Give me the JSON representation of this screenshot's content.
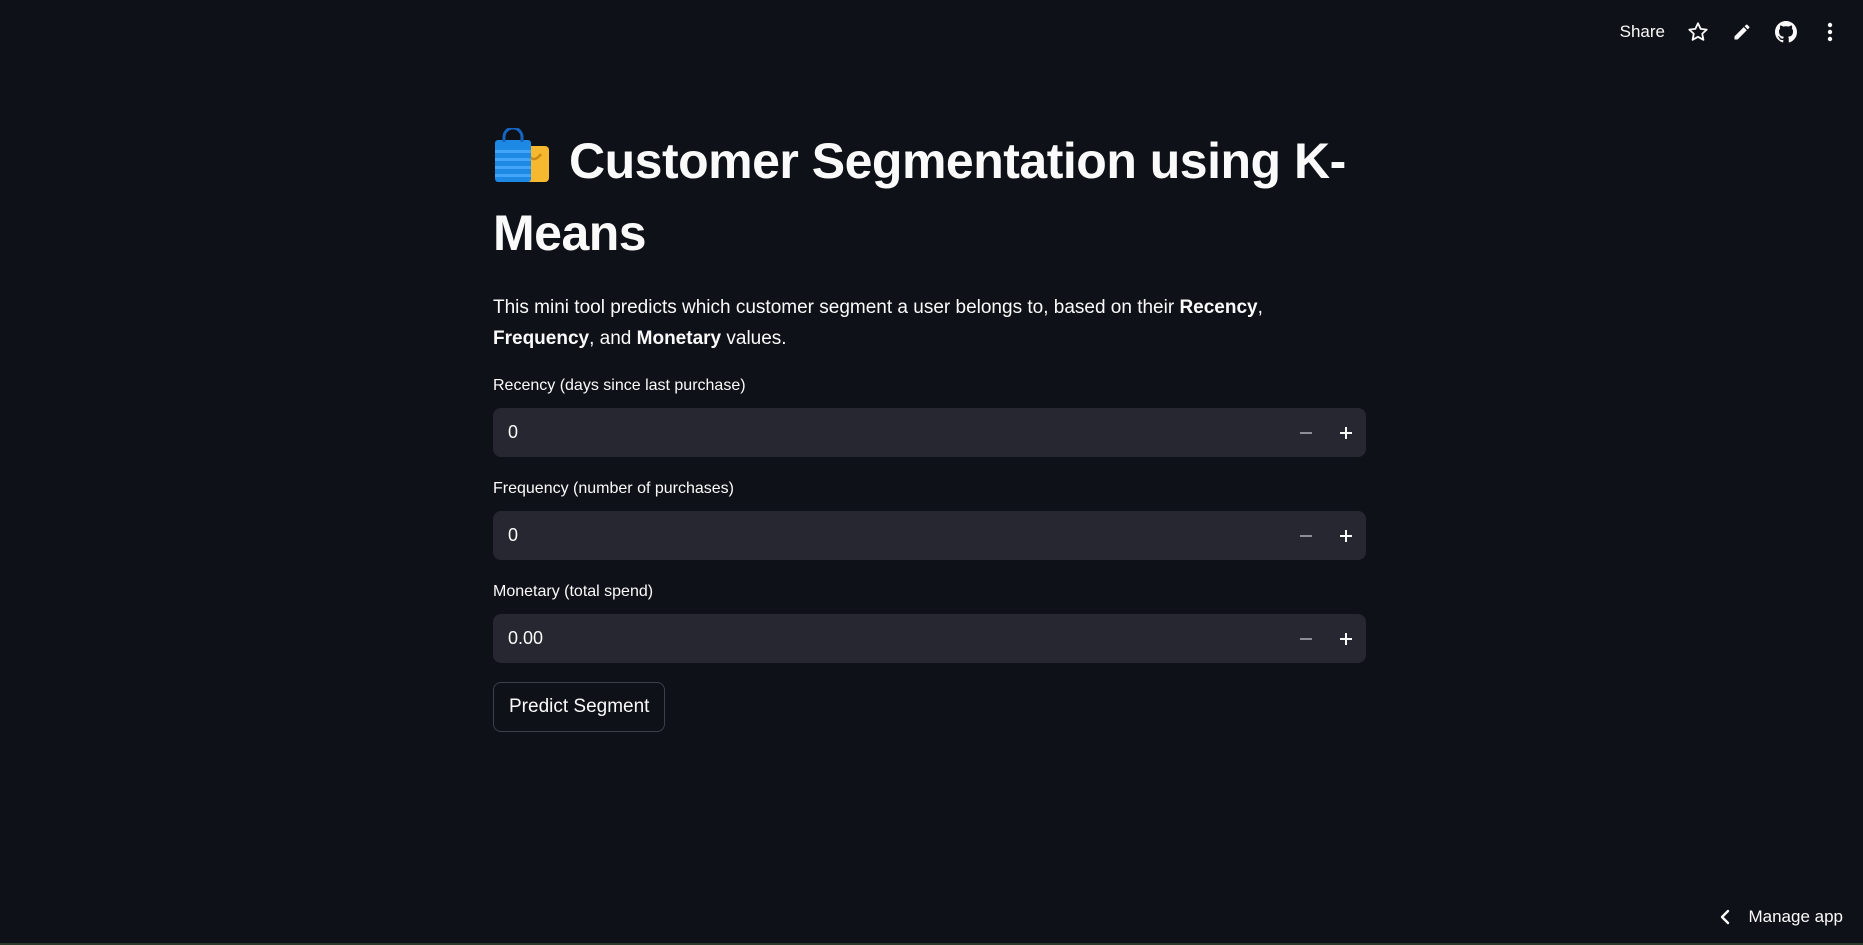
{
  "toolbar": {
    "share_label": "Share",
    "icons": [
      "star-icon",
      "pencil-icon",
      "github-icon",
      "more-vertical-icon"
    ]
  },
  "header": {
    "emoji": "shopping-bags-icon",
    "title": "Customer Segmentation using K-Means"
  },
  "description": {
    "part1": "This mini tool predicts which customer segment a user belongs to, based on their ",
    "recency": "Recency",
    "sep1": ", ",
    "frequency": "Frequency",
    "sep2": ", and ",
    "monetary": "Monetary",
    "part2": " values."
  },
  "fields": [
    {
      "label": "Recency (days since last purchase)",
      "value": "0"
    },
    {
      "label": "Frequency (number of purchases)",
      "value": "0"
    },
    {
      "label": "Monetary (total spend)",
      "value": "0.00"
    }
  ],
  "predict_button": "Predict Segment",
  "footer": {
    "manage_label": "Manage app"
  },
  "colors": {
    "background": "#0e1117",
    "input_bg": "#262730",
    "text": "#fafafa"
  }
}
